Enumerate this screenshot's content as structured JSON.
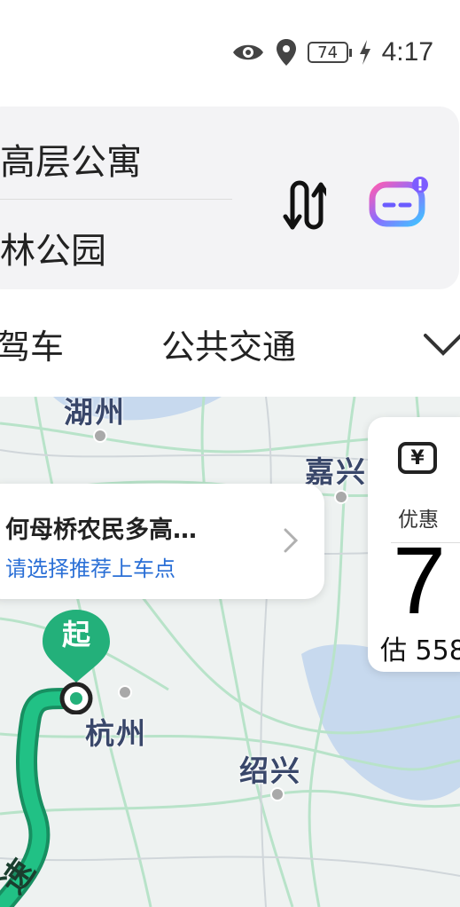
{
  "status_bar": {
    "battery": "74",
    "time": "4:17"
  },
  "route": {
    "origin": "高层公寓",
    "destination": "林公园"
  },
  "modes": [
    "驾车",
    "公共交通"
  ],
  "map": {
    "cities": [
      "湖州",
      "嘉兴",
      "杭州",
      "绍兴"
    ],
    "start_label": "起",
    "highway_label": "速"
  },
  "pickup": {
    "title": "何母桥农民多高…",
    "subtitle": "请选择推荐上车点"
  },
  "price_panel": {
    "deal_label": "优惠",
    "big_value": "7",
    "estimate": "估 558"
  },
  "colors": {
    "route_green": "#1fae77",
    "link_blue": "#2a6fd6",
    "pin_green": "#23b07a"
  }
}
